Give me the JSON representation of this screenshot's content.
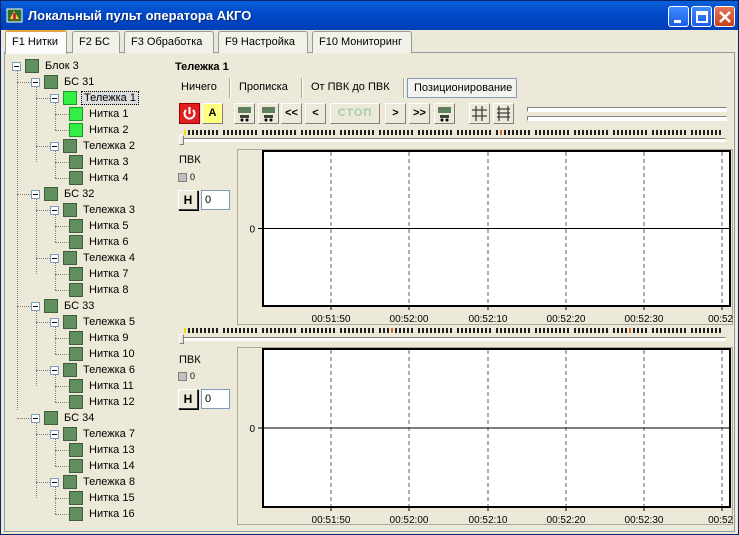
{
  "window": {
    "title": "Локальный пульт оператора АКГО"
  },
  "tabs": [
    {
      "label": "F1 Нитки",
      "active": true
    },
    {
      "label": "F2 БС",
      "active": false
    },
    {
      "label": "F3 Обработка",
      "active": false
    },
    {
      "label": "F9 Настройка",
      "active": false
    },
    {
      "label": "F10 Мониторинг",
      "active": false
    }
  ],
  "tree": {
    "root": "Блок 3",
    "groups": [
      {
        "label": "БС 31",
        "carts": [
          {
            "label": "Тележка 1",
            "lit": true,
            "selected": true,
            "threads": [
              {
                "label": "Нитка 1",
                "lit": true
              },
              {
                "label": "Нитка 2",
                "lit": true
              }
            ]
          },
          {
            "label": "Тележка 2",
            "lit": false,
            "selected": false,
            "threads": [
              {
                "label": "Нитка 3",
                "lit": false
              },
              {
                "label": "Нитка 4",
                "lit": false
              }
            ]
          }
        ]
      },
      {
        "label": "БС 32",
        "carts": [
          {
            "label": "Тележка 3",
            "lit": false,
            "selected": false,
            "threads": [
              {
                "label": "Нитка 5",
                "lit": false
              },
              {
                "label": "Нитка 6",
                "lit": false
              }
            ]
          },
          {
            "label": "Тележка 4",
            "lit": false,
            "selected": false,
            "threads": [
              {
                "label": "Нитка 7",
                "lit": false
              },
              {
                "label": "Нитка 8",
                "lit": false
              }
            ]
          }
        ]
      },
      {
        "label": "БС 33",
        "carts": [
          {
            "label": "Тележка 5",
            "lit": false,
            "selected": false,
            "threads": [
              {
                "label": "Нитка 9",
                "lit": false
              },
              {
                "label": "Нитка 10",
                "lit": false
              }
            ]
          },
          {
            "label": "Тележка 6",
            "lit": false,
            "selected": false,
            "threads": [
              {
                "label": "Нитка 11",
                "lit": false
              },
              {
                "label": "Нитка 12",
                "lit": false
              }
            ]
          }
        ]
      },
      {
        "label": "БС 34",
        "carts": [
          {
            "label": "Тележка 7",
            "lit": false,
            "selected": false,
            "threads": [
              {
                "label": "Нитка 13",
                "lit": false
              },
              {
                "label": "Нитка 14",
                "lit": false
              }
            ]
          },
          {
            "label": "Тележка 8",
            "lit": false,
            "selected": false,
            "threads": [
              {
                "label": "Нитка 15",
                "lit": false
              },
              {
                "label": "Нитка 16",
                "lit": false
              }
            ]
          }
        ]
      }
    ]
  },
  "cart_panel": {
    "title": "Тележка 1",
    "subtabs": [
      {
        "label": "Ничего",
        "active": false
      },
      {
        "label": "Прописка",
        "active": false
      },
      {
        "label": "От ПВК до ПВК",
        "active": false
      },
      {
        "label": "Позиционирование",
        "active": true
      }
    ],
    "toolbar": {
      "power_icon": "power-icon",
      "auto_label": "A",
      "rewind_label": "<<",
      "back_label": "<",
      "stop_label": "СТОП",
      "forward_label": ">",
      "fast_forward_label": ">>"
    },
    "channels": [
      {
        "pvk_label": "ПВК",
        "led_text": "0",
        "h_label": "Н",
        "input_value": "0"
      },
      {
        "pvk_label": "ПВК",
        "led_text": "0",
        "h_label": "Н",
        "input_value": "0"
      }
    ]
  },
  "chart_data": [
    {
      "type": "line",
      "y_tick": "0",
      "x_ticks": [
        "00:51:50",
        "00:52:00",
        "00:52:10",
        "00:52:20",
        "00:52:30",
        "00:52:"
      ],
      "series": [
        {
          "values": [
            0,
            0
          ]
        }
      ]
    },
    {
      "type": "line",
      "y_tick": "0",
      "x_ticks": [
        "00:51:50",
        "00:52:00",
        "00:52:10",
        "00:52:20",
        "00:52:30",
        "00:52:"
      ],
      "series": [
        {
          "values": [
            0,
            0
          ]
        }
      ]
    }
  ],
  "colors": {
    "titlebar": "#0049c8",
    "lit_led": "#33ee44",
    "unlit_led": "#5f8f5f",
    "power_button": "#e02020",
    "auto_button": "#ffff80",
    "active_tab_accent": "#e6a33c"
  }
}
